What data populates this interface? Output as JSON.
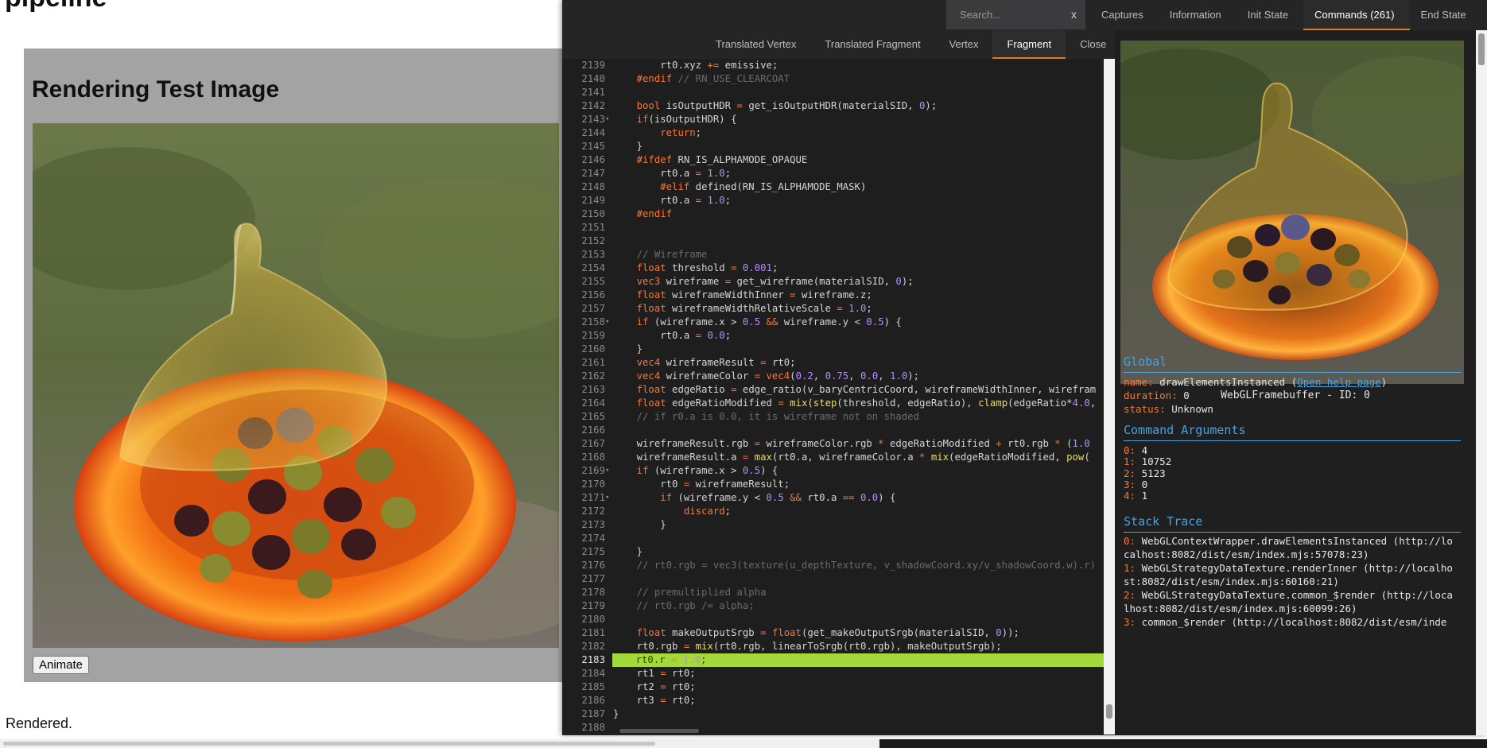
{
  "page": {
    "heading": "pipeline",
    "test_title": "Rendering Test Image",
    "animate_label": "Animate",
    "status_text": "Rendered."
  },
  "inspector": {
    "search_placeholder": "Search...",
    "search_clear": "x",
    "top_tabs": [
      "Captures",
      "Information",
      "Init State",
      "Commands (261)",
      "End State"
    ],
    "active_top_tab": "Commands (261)",
    "shader_tabs": [
      "Translated Vertex",
      "Translated Fragment",
      "Vertex",
      "Fragment",
      "Close"
    ],
    "active_shader_tab": "Fragment",
    "highlighted_line": "2183",
    "code_lines": [
      {
        "n": "2139",
        "fold": false,
        "code": "        rt0.xyz += emissive;"
      },
      {
        "n": "2140",
        "fold": false,
        "code": "    #endif // RN_USE_CLEARCOAT"
      },
      {
        "n": "2141",
        "fold": false,
        "code": ""
      },
      {
        "n": "2142",
        "fold": false,
        "code": "    bool isOutputHDR = get_isOutputHDR(materialSID, 0);"
      },
      {
        "n": "2143",
        "fold": true,
        "code": "    if(isOutputHDR) {"
      },
      {
        "n": "2144",
        "fold": false,
        "code": "        return;"
      },
      {
        "n": "2145",
        "fold": false,
        "code": "    }"
      },
      {
        "n": "2146",
        "fold": false,
        "code": "    #ifdef RN_IS_ALPHAMODE_OPAQUE"
      },
      {
        "n": "2147",
        "fold": false,
        "code": "        rt0.a = 1.0;"
      },
      {
        "n": "2148",
        "fold": false,
        "code": "        #elif defined(RN_IS_ALPHAMODE_MASK)"
      },
      {
        "n": "2149",
        "fold": false,
        "code": "        rt0.a = 1.0;"
      },
      {
        "n": "2150",
        "fold": false,
        "code": "    #endif"
      },
      {
        "n": "2151",
        "fold": false,
        "code": ""
      },
      {
        "n": "2152",
        "fold": false,
        "code": ""
      },
      {
        "n": "2153",
        "fold": false,
        "code": "    // Wireframe"
      },
      {
        "n": "2154",
        "fold": false,
        "code": "    float threshold = 0.001;"
      },
      {
        "n": "2155",
        "fold": false,
        "code": "    vec3 wireframe = get_wireframe(materialSID, 0);"
      },
      {
        "n": "2156",
        "fold": false,
        "code": "    float wireframeWidthInner = wireframe.z;"
      },
      {
        "n": "2157",
        "fold": false,
        "code": "    float wireframeWidthRelativeScale = 1.0;"
      },
      {
        "n": "2158",
        "fold": true,
        "code": "    if (wireframe.x > 0.5 && wireframe.y < 0.5) {"
      },
      {
        "n": "2159",
        "fold": false,
        "code": "        rt0.a = 0.0;"
      },
      {
        "n": "2160",
        "fold": false,
        "code": "    }"
      },
      {
        "n": "2161",
        "fold": false,
        "code": "    vec4 wireframeResult = rt0;"
      },
      {
        "n": "2162",
        "fold": false,
        "code": "    vec4 wireframeColor = vec4(0.2, 0.75, 0.0, 1.0);"
      },
      {
        "n": "2163",
        "fold": false,
        "code": "    float edgeRatio = edge_ratio(v_baryCentricCoord, wireframeWidthInner, wirefram"
      },
      {
        "n": "2164",
        "fold": false,
        "code": "    float edgeRatioModified = mix(step(threshold, edgeRatio), clamp(edgeRatio*4.0,"
      },
      {
        "n": "2165",
        "fold": false,
        "code": "    // if r0.a is 0.0, it is wireframe not on shaded"
      },
      {
        "n": "2166",
        "fold": false,
        "code": ""
      },
      {
        "n": "2167",
        "fold": false,
        "code": "    wireframeResult.rgb = wireframeColor.rgb * edgeRatioModified + rt0.rgb * (1.0"
      },
      {
        "n": "2168",
        "fold": false,
        "code": "    wireframeResult.a = max(rt0.a, wireframeColor.a * mix(edgeRatioModified, pow("
      },
      {
        "n": "2169",
        "fold": true,
        "code": "    if (wireframe.x > 0.5) {"
      },
      {
        "n": "2170",
        "fold": false,
        "code": "        rt0 = wireframeResult;"
      },
      {
        "n": "2171",
        "fold": true,
        "code": "        if (wireframe.y < 0.5 && rt0.a == 0.0) {"
      },
      {
        "n": "2172",
        "fold": false,
        "code": "            discard;"
      },
      {
        "n": "2173",
        "fold": false,
        "code": "        }"
      },
      {
        "n": "2174",
        "fold": false,
        "code": ""
      },
      {
        "n": "2175",
        "fold": false,
        "code": "    }"
      },
      {
        "n": "2176",
        "fold": false,
        "code": "    // rt0.rgb = vec3(texture(u_depthTexture, v_shadowCoord.xy/v_shadowCoord.w).r)"
      },
      {
        "n": "2177",
        "fold": false,
        "code": ""
      },
      {
        "n": "2178",
        "fold": false,
        "code": "    // premultiplied alpha"
      },
      {
        "n": "2179",
        "fold": false,
        "code": "    // rt0.rgb /= alpha;"
      },
      {
        "n": "2180",
        "fold": false,
        "code": ""
      },
      {
        "n": "2181",
        "fold": false,
        "code": "    float makeOutputSrgb = float(get_makeOutputSrgb(materialSID, 0));"
      },
      {
        "n": "2182",
        "fold": false,
        "code": "    rt0.rgb = mix(rt0.rgb, linearToSrgb(rt0.rgb), makeOutputSrgb);"
      },
      {
        "n": "2183",
        "fold": false,
        "code": "    rt0.r = 1.0;"
      },
      {
        "n": "2184",
        "fold": false,
        "code": "    rt1 = rt0;"
      },
      {
        "n": "2185",
        "fold": false,
        "code": "    rt2 = rt0;"
      },
      {
        "n": "2186",
        "fold": false,
        "code": "    rt3 = rt0;"
      },
      {
        "n": "2187",
        "fold": false,
        "code": "}"
      },
      {
        "n": "2188",
        "fold": false,
        "code": ""
      }
    ],
    "framebuffer_caption": "WebGLFramebuffer - ID: 0",
    "global": {
      "title": "Global",
      "name_key": "name:",
      "name_value": "drawElementsInstanced",
      "help_link": "Open help page",
      "duration_key": "duration:",
      "duration_value": "0",
      "status_key": "status:",
      "status_value": "Unknown"
    },
    "command_args": {
      "title": "Command Arguments",
      "items": [
        {
          "k": "0:",
          "v": "4"
        },
        {
          "k": "1:",
          "v": "10752"
        },
        {
          "k": "2:",
          "v": "5123"
        },
        {
          "k": "3:",
          "v": "0"
        },
        {
          "k": "4:",
          "v": "1"
        }
      ]
    },
    "stack_trace": {
      "title": "Stack Trace",
      "items": [
        {
          "k": "0:",
          "v": "WebGLContextWrapper.drawElementsInstanced (http://localhost:8082/dist/esm/index.mjs:57078:23)"
        },
        {
          "k": "1:",
          "v": "WebGLStrategyDataTexture.renderInner (http://localhost:8082/dist/esm/index.mjs:60160:21)"
        },
        {
          "k": "2:",
          "v": "WebGLStrategyDataTexture.common_$render (http://localhost:8082/dist/esm/index.mjs:60099:26)"
        },
        {
          "k": "3:",
          "v": "common_$render (http://localhost:8082/dist/esm/inde"
        }
      ]
    }
  }
}
